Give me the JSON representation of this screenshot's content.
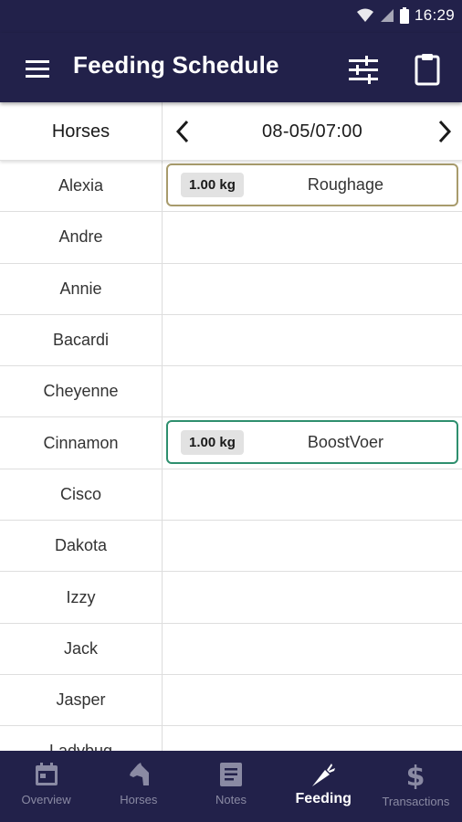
{
  "status_bar": {
    "time": "16:29"
  },
  "app_bar": {
    "title": "Feeding Schedule"
  },
  "schedule": {
    "horses_header": "Horses",
    "date_time": "08-05/07:00"
  },
  "horses": [
    {
      "name": "Alexia",
      "feed": {
        "qty": "1.00 kg",
        "name": "Roughage",
        "border": "#a89b6c"
      }
    },
    {
      "name": "Andre"
    },
    {
      "name": "Annie"
    },
    {
      "name": "Bacardi"
    },
    {
      "name": "Cheyenne"
    },
    {
      "name": "Cinnamon",
      "feed": {
        "qty": "1.00 kg",
        "name": "BoostVoer",
        "border": "#2e8f6e"
      }
    },
    {
      "name": "Cisco"
    },
    {
      "name": "Dakota"
    },
    {
      "name": "Izzy"
    },
    {
      "name": "Jack"
    },
    {
      "name": "Jasper"
    },
    {
      "name": "Ladybug"
    }
  ],
  "bottom_nav": {
    "items": [
      {
        "label": "Overview",
        "icon": "calendar-icon",
        "active": false
      },
      {
        "label": "Horses",
        "icon": "horse-head-icon",
        "active": false
      },
      {
        "label": "Notes",
        "icon": "note-icon",
        "active": false
      },
      {
        "label": "Feeding",
        "icon": "carrot-icon",
        "active": true
      },
      {
        "label": "Transactions",
        "icon": "dollar-icon",
        "active": false
      }
    ]
  },
  "colors": {
    "primary_dark": "#22214a",
    "nav_inactive": "#8a8aa3",
    "nav_active": "#ffffff"
  }
}
